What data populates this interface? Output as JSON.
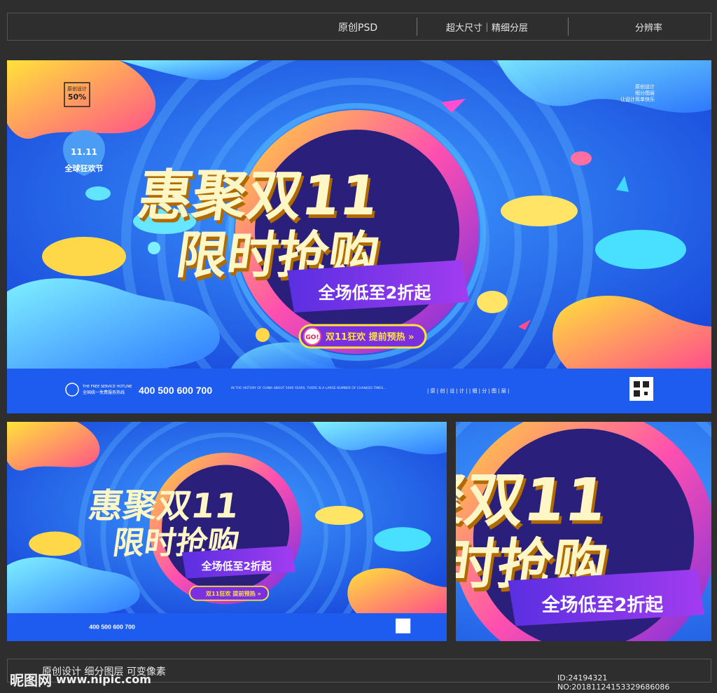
{
  "header": {
    "item1": "原创PSD",
    "item2": "超大尺寸｜精细分层",
    "item3": "分辨率"
  },
  "banner": {
    "title_line1": "惠聚双11",
    "title_line2": "限时抢购",
    "subtitle": "全场低至2折起",
    "go_badge": "GO!",
    "cta_text": "双11狂欢  提前预热 »",
    "badge_top": "原创设计",
    "badge_percent": "50%",
    "badge_date": "11.11",
    "badge_festival": "全球狂欢节",
    "side_note1": "原创设计",
    "side_note2": "细分图层",
    "side_note3": "让设计简单快乐",
    "hotline_label": "THE FREE SERVICE HOTLINE",
    "hotline_sub": "全国统一免费服务热线",
    "hotline_number": "400 500 600 700",
    "footer_english": "IN THE HISTORY OF CHINA ABOUT 5000 YEARS, THERE IS A LARGE NUMBER OF CHANGES TIMES...",
    "footer_tags": "| 原 | 创 | 设 | 计 |    | 细 | 分 | 图 | 层 |"
  },
  "footer": {
    "caption": "原创设计 细分图层 可变像素",
    "watermark_logo": "昵图网",
    "watermark_url": "www.nipic.com",
    "image_id": "ID:24194321 NO:20181124153329686086"
  },
  "colors": {
    "background": "#2e2e2e",
    "banner_blue": "#1e5cf0",
    "accent_yellow": "#ffe23a",
    "accent_purple": "#7a2fe0",
    "accent_pink": "#ff4f8b",
    "accent_cyan": "#3fd8ff"
  }
}
